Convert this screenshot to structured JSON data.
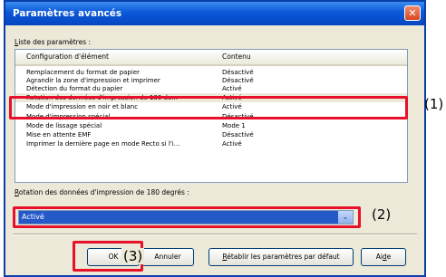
{
  "dialog": {
    "title": "Paramètres avancés",
    "close_glyph": "✕"
  },
  "settings_list": {
    "label_u": "L",
    "label_rest": "iste des paramètres :",
    "columns": [
      "Configuration d'élément",
      "Contenu"
    ],
    "rows": [
      {
        "name": "Remplacement du format de papier",
        "value": "Désactivé"
      },
      {
        "name": "Agrandir la zone d'impression et imprimer",
        "value": "Désactivé"
      },
      {
        "name": "Détection du format du papier",
        "value": "Activé"
      },
      {
        "name": "Rotation des données d'impression de 180 de...",
        "value": "Activé"
      },
      {
        "name": "Mode d'impression en noir et blanc",
        "value": "Activé"
      },
      {
        "name": "Mode d'impression spécial",
        "value": "Désactivé"
      },
      {
        "name": "Mode de lissage spécial",
        "value": "Mode 1"
      },
      {
        "name": "Mise en attente EMF",
        "value": "Désactivé"
      },
      {
        "name": "Imprimer la dernière page en mode Recto si l'i...",
        "value": "Activé"
      }
    ]
  },
  "selection": {
    "label_u": "R",
    "label_rest": "otation des données d'impression de 180 degrés :",
    "value": "Activé",
    "arrow_glyph": "⌄"
  },
  "buttons": {
    "ok": "OK",
    "cancel": "Annuler",
    "reset_u": "R",
    "reset_rest": "établir les paramètres par défaut",
    "help_pre": "Ai",
    "help_u": "d",
    "help_post": "e"
  },
  "callouts": {
    "one": "(1)",
    "two": "(2)",
    "three": "(3)"
  },
  "colors": {
    "callout_red": "#e8102a",
    "title_blue": "#0a58d8",
    "selection_blue": "#2659c8"
  }
}
